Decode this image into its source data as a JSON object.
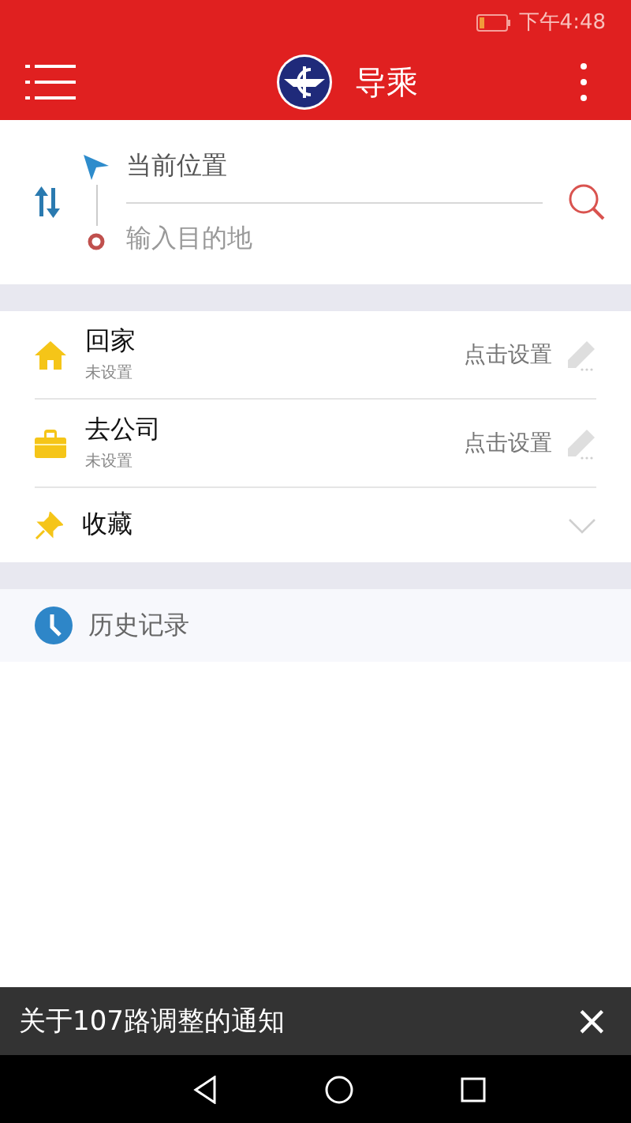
{
  "status_bar": {
    "time": "下午4:48"
  },
  "toolbar": {
    "title": "导乘"
  },
  "route": {
    "origin": {
      "value": "当前位置"
    },
    "destination": {
      "placeholder": "输入目的地"
    }
  },
  "places": [
    {
      "kind": "home",
      "name": "回家",
      "subtitle": "未设置",
      "action": "点击设置"
    },
    {
      "kind": "work",
      "name": "去公司",
      "subtitle": "未设置",
      "action": "点击设置"
    },
    {
      "kind": "favorites",
      "name": "收藏",
      "expanded": false
    }
  ],
  "history": {
    "label": "历史记录"
  },
  "notice": {
    "text": "关于107路调整的通知",
    "close": "×"
  }
}
